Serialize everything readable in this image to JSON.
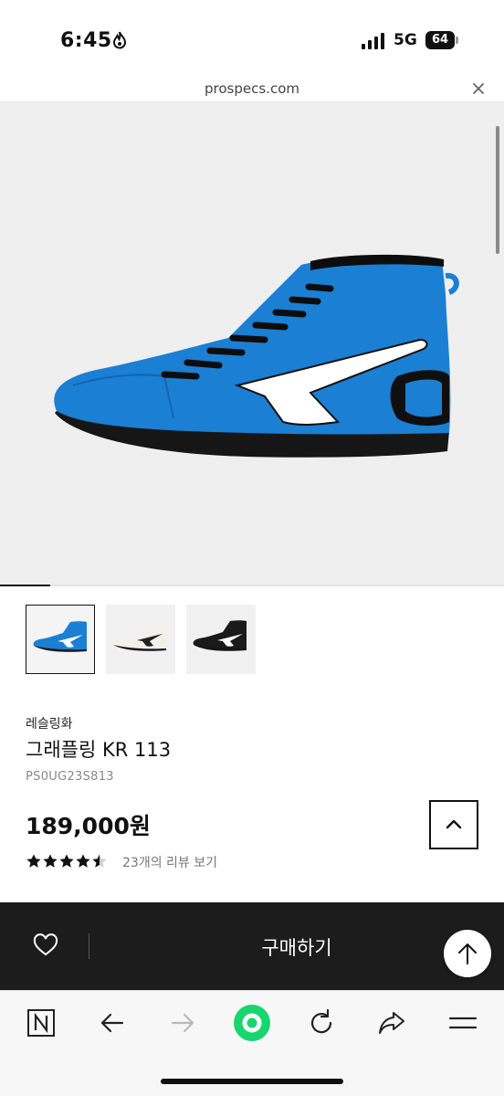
{
  "status_bar": {
    "time": "6:45",
    "network": "5G",
    "battery": "64"
  },
  "browser": {
    "url": "prospecs.com"
  },
  "gallery": {
    "image_count": 1,
    "progress": 0.1,
    "main_color": "#1b7fd3",
    "variants": [
      {
        "color": "#1b7fd3",
        "stripe": "#ffffff",
        "active": true
      },
      {
        "color": "#f2f0ea",
        "stripe": "#222222",
        "active": false
      },
      {
        "color": "#1a1a1a",
        "stripe": "#ffffff",
        "active": false
      }
    ]
  },
  "product": {
    "category": "레슬링화",
    "name": "그래플링 KR 113",
    "code": "PS0UG23S813",
    "price": "189,000원",
    "rating": 4.5,
    "review_link": "23개의 리뷰 보기"
  },
  "purchase_bar": {
    "buy_label": "구매하기"
  },
  "colors": {
    "accent_green": "#19d56e",
    "purchase_bg": "#1c1c1c"
  }
}
